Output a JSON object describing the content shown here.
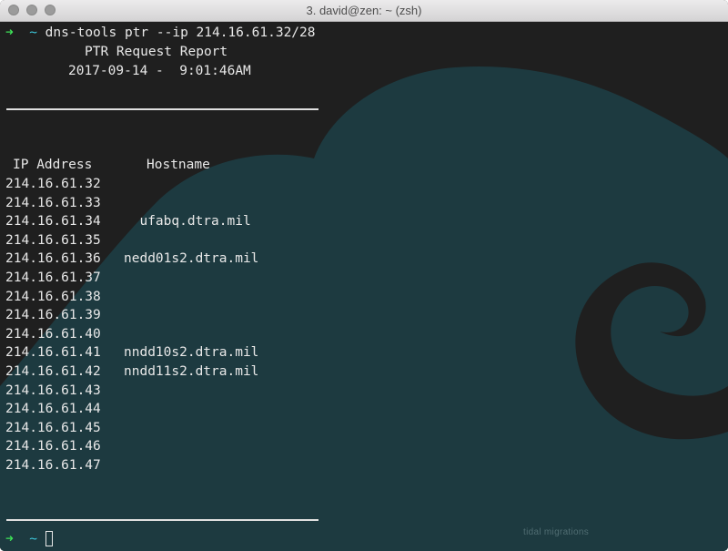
{
  "window": {
    "title": "3. david@zen: ~ (zsh)"
  },
  "prompt": {
    "arrow": "➜",
    "dir": "~",
    "command": "dns-tools ptr --ip 214.16.61.32/28"
  },
  "report": {
    "heading": "PTR Request Report",
    "timestamp": "2017-09-14 -  9:01:46AM",
    "col_ip": "IP Address",
    "col_host": "Hostname",
    "rows": [
      {
        "ip": "214.16.61.32",
        "host": ""
      },
      {
        "ip": "214.16.61.33",
        "host": ""
      },
      {
        "ip": "214.16.61.34",
        "host": "  ufabq.dtra.mil"
      },
      {
        "ip": "214.16.61.35",
        "host": ""
      },
      {
        "ip": "214.16.61.36",
        "host": "nedd01s2.dtra.mil"
      },
      {
        "ip": "214.16.61.37",
        "host": ""
      },
      {
        "ip": "214.16.61.38",
        "host": ""
      },
      {
        "ip": "214.16.61.39",
        "host": ""
      },
      {
        "ip": "214.16.61.40",
        "host": ""
      },
      {
        "ip": "214.16.61.41",
        "host": "nndd10s2.dtra.mil"
      },
      {
        "ip": "214.16.61.42",
        "host": "nndd11s2.dtra.mil"
      },
      {
        "ip": "214.16.61.43",
        "host": ""
      },
      {
        "ip": "214.16.61.44",
        "host": ""
      },
      {
        "ip": "214.16.61.45",
        "host": ""
      },
      {
        "ip": "214.16.61.46",
        "host": ""
      },
      {
        "ip": "214.16.61.47",
        "host": ""
      }
    ]
  },
  "prompt2": {
    "arrow": "➜",
    "dir": "~"
  },
  "watermark": "tidal migrations",
  "colors": {
    "arrow": "#3ee157",
    "dir": "#3dc6d9",
    "wave": "#1d3a40",
    "background": "#1f1f1f"
  },
  "icons": {
    "close": "close-button-icon",
    "minimize": "minimize-button-icon",
    "maximize": "maximize-button-icon"
  }
}
